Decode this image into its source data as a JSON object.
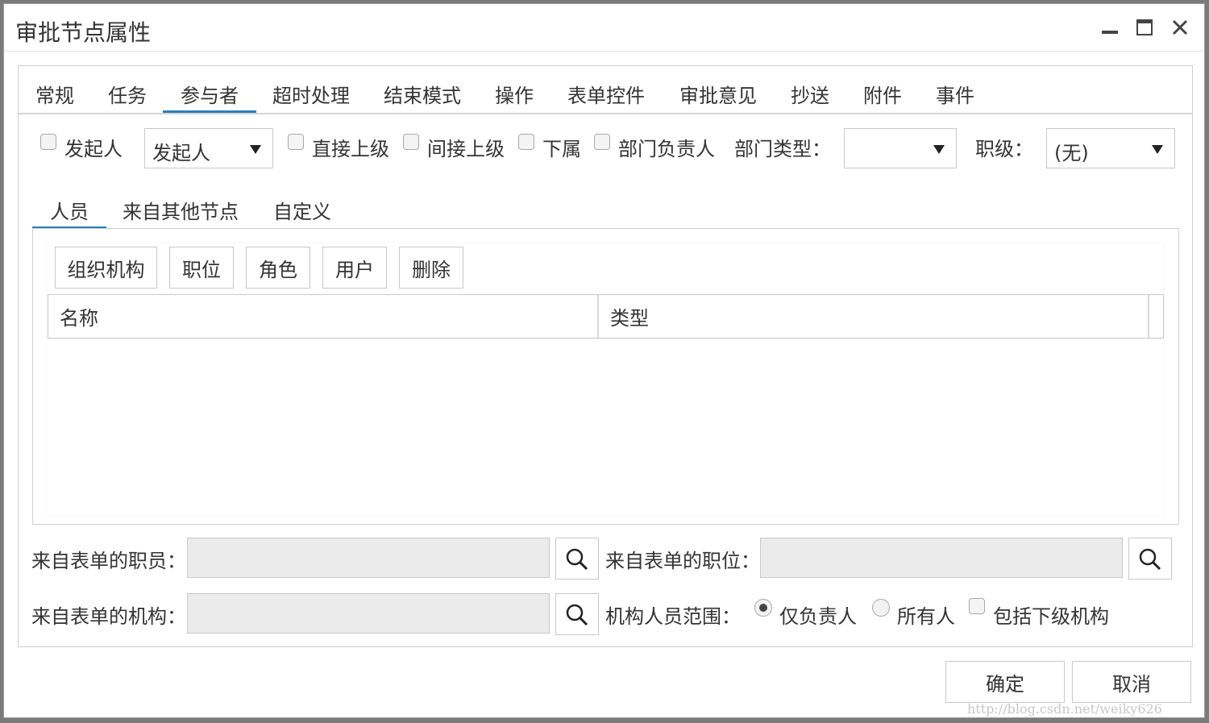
{
  "window": {
    "title": "审批节点属性"
  },
  "tabs": [
    {
      "label": "常规"
    },
    {
      "label": "任务"
    },
    {
      "label": "参与者",
      "active": true
    },
    {
      "label": "超时处理"
    },
    {
      "label": "结束模式"
    },
    {
      "label": "操作"
    },
    {
      "label": "表单控件"
    },
    {
      "label": "审批意见"
    },
    {
      "label": "抄送"
    },
    {
      "label": "附件"
    },
    {
      "label": "事件"
    }
  ],
  "participant_options": {
    "initiator_label": "发起人",
    "initiator_select": "发起人",
    "direct_superior": "直接上级",
    "indirect_superior": "间接上级",
    "subordinate": "下属",
    "dept_head": "部门负责人",
    "dept_type_label": "部门类型：",
    "dept_type_value": "",
    "rank_label": "职级：",
    "rank_value": "(无)"
  },
  "subtabs": [
    {
      "label": "人员",
      "active": true
    },
    {
      "label": "来自其他节点"
    },
    {
      "label": "自定义"
    }
  ],
  "toolbar": {
    "org": "组织机构",
    "position": "职位",
    "role": "角色",
    "user": "用户",
    "delete": "删除"
  },
  "table": {
    "columns": [
      "名称",
      "类型"
    ],
    "rows": []
  },
  "form_fields": {
    "staff_label": "来自表单的职员：",
    "staff_value": "",
    "position_label": "来自表单的职位：",
    "position_value": "",
    "org_label": "来自表单的机构：",
    "org_value": "",
    "scope_label": "机构人员范围：",
    "scope_options": [
      "仅负责人",
      "所有人"
    ],
    "scope_selected": "仅负责人",
    "include_sub_label": "包括下级机构"
  },
  "footer": {
    "ok": "确定",
    "cancel": "取消"
  },
  "watermark": "http://blog.csdn.net/weiky626",
  "colors": {
    "accent": "#2a7fbf",
    "input_bg": "#ebebeb",
    "border": "#c9c9c9"
  }
}
